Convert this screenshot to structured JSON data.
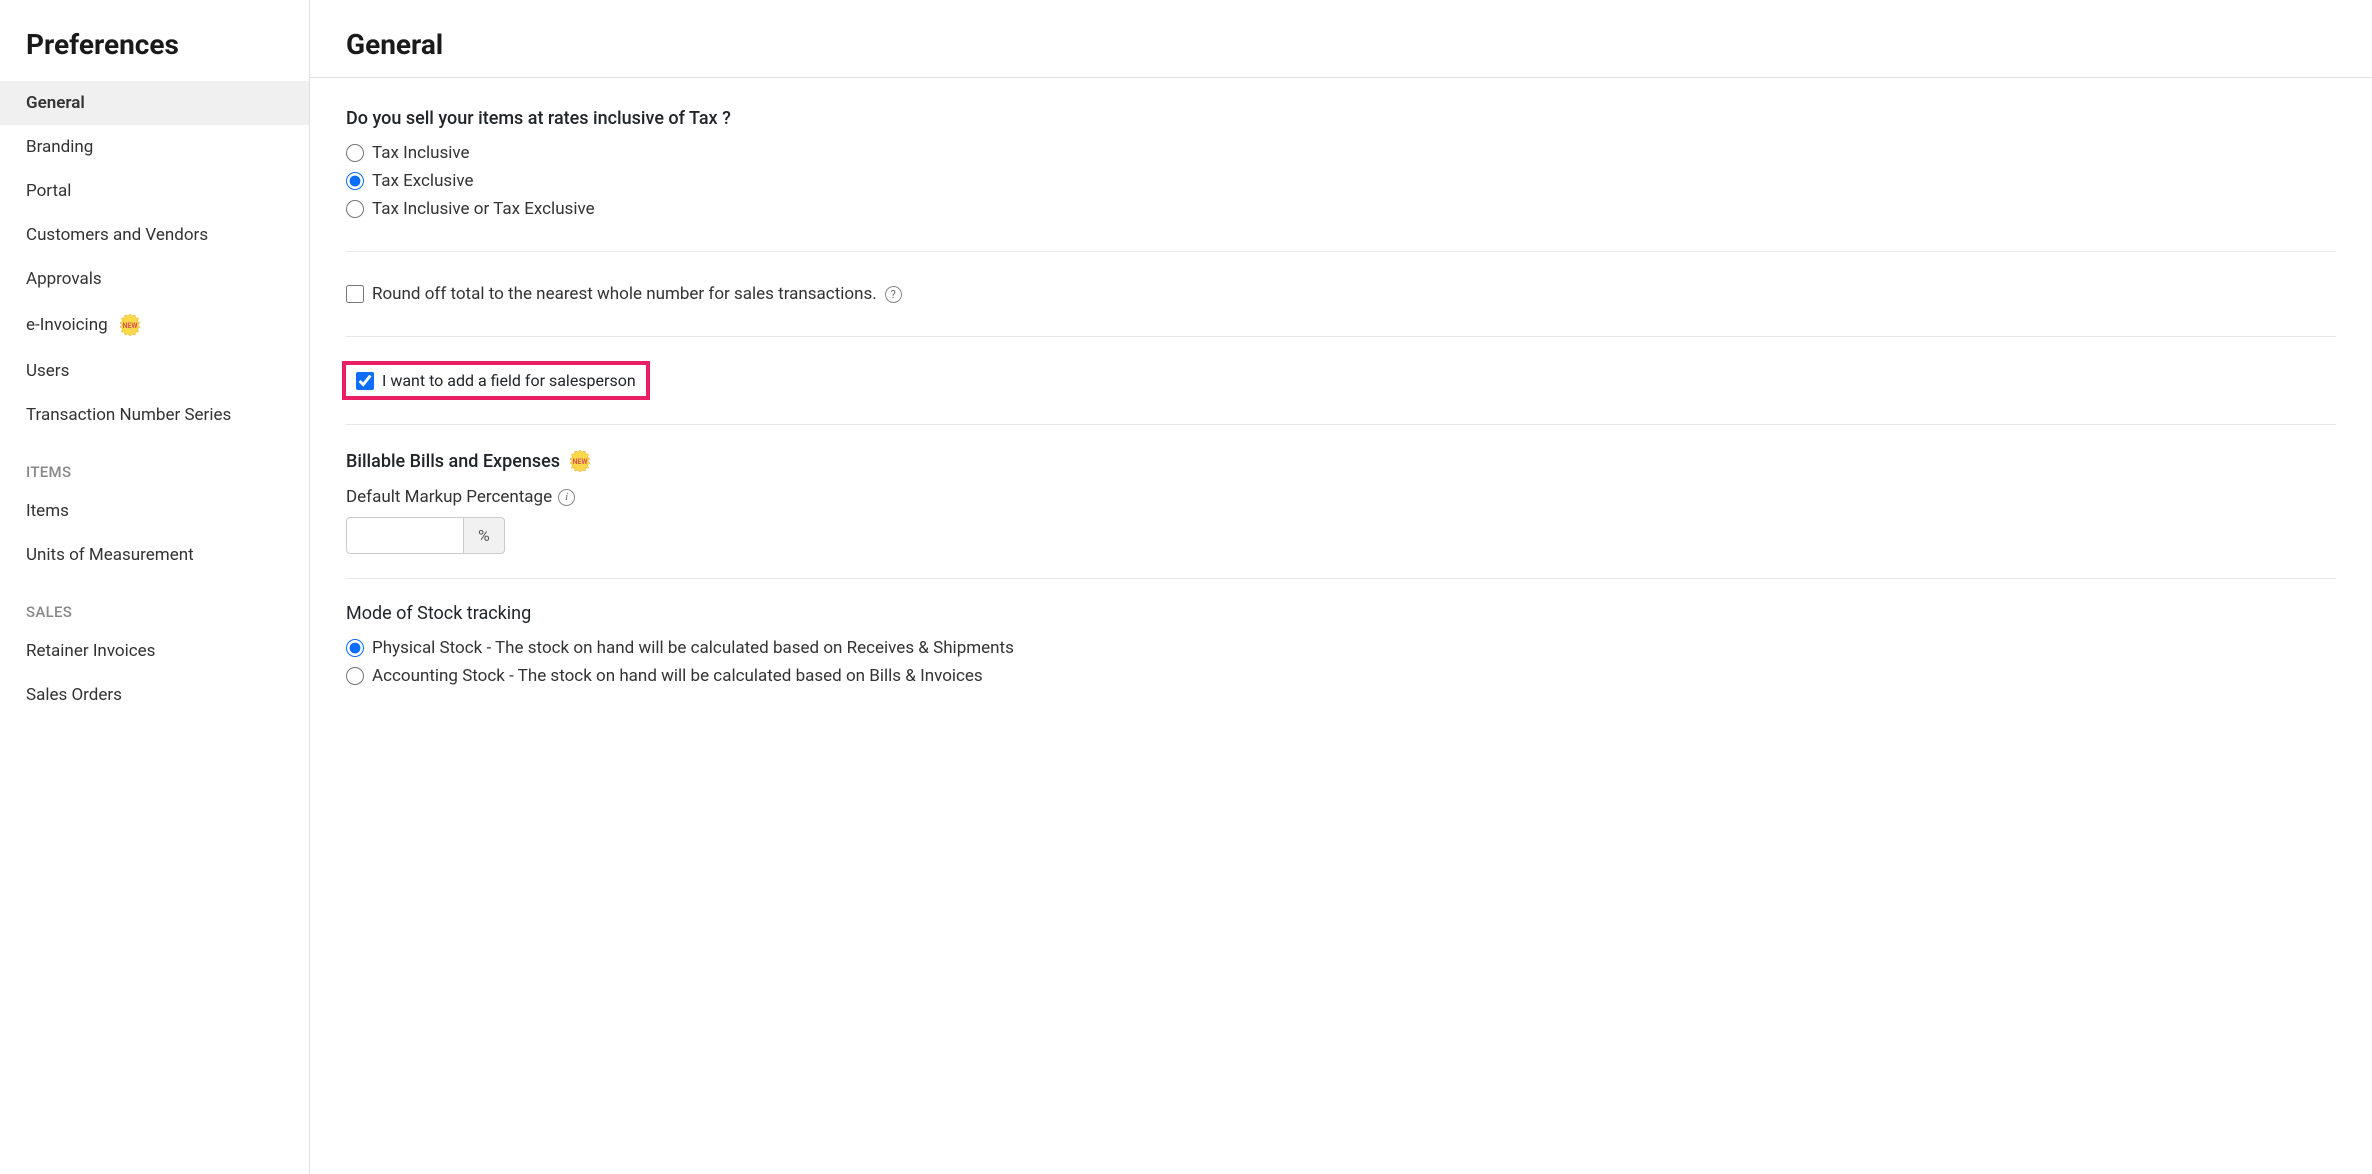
{
  "sidebar": {
    "title": "Preferences",
    "general": "General",
    "branding": "Branding",
    "portal": "Portal",
    "customers_vendors": "Customers and Vendors",
    "approvals": "Approvals",
    "einvoicing": "e-Invoicing",
    "users": "Users",
    "txn_series": "Transaction Number Series",
    "group_items": "ITEMS",
    "items": "Items",
    "uom": "Units of Measurement",
    "group_sales": "SALES",
    "retainer_invoices": "Retainer Invoices",
    "sales_orders": "Sales Orders"
  },
  "main": {
    "title": "General",
    "tax": {
      "question": "Do you sell your items at rates inclusive of Tax ?",
      "opt_inclusive": "Tax Inclusive",
      "opt_exclusive": "Tax Exclusive",
      "opt_both": "Tax Inclusive or Tax Exclusive"
    },
    "roundoff": {
      "label": "Round off total to the nearest whole number for sales transactions."
    },
    "salesperson": {
      "label": "I want to add a field for salesperson"
    },
    "billable": {
      "heading": "Billable Bills and Expenses",
      "markup_label": "Default Markup Percentage",
      "markup_suffix": "%"
    },
    "stock": {
      "heading": "Mode of Stock tracking",
      "opt_physical": "Physical Stock - The stock on hand will be calculated based on Receives & Shipments",
      "opt_accounting": "Accounting Stock - The stock on hand will be calculated based on Bills & Invoices"
    }
  }
}
